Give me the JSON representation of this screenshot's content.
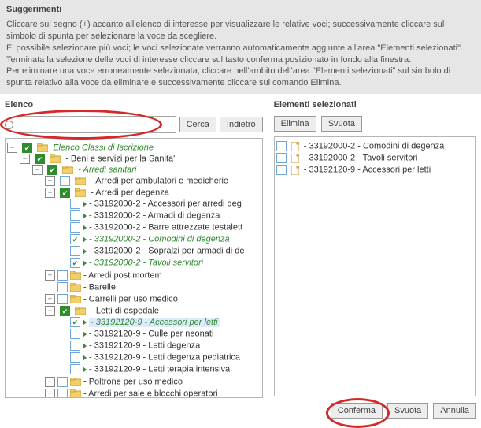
{
  "hints": {
    "title": "Suggerimenti",
    "p1": "Cliccare sul segno (+) accanto all'elenco di interesse per visualizzare le relative voci; successivamente cliccare sul simbolo di spunta per selezionare la voce da scegliere.",
    "p2": "E' possibile selezionare più voci; le voci selezionate verranno automaticamente aggiunte all'area \"Elementi selezionati\".",
    "p3": "Terminata la selezione delle voci di interesse cliccare sul tasto conferma posizionato in fondo alla finestra.",
    "p4": "Per eliminare una voce erroneamente selezionata, cliccare nell'ambito dell'area \"Elementi selezionati\" sul simbolo di spunta relativo alla voce da eliminare e successivamente cliccare sul comando Elimina."
  },
  "left": {
    "title": "Elenco",
    "search_value": "",
    "btn_search": "Cerca",
    "btn_back": "Indietro"
  },
  "right": {
    "title": "Elementi selezionati",
    "btn_del": "Elimina",
    "btn_empty_top": "Svuota",
    "btn_confirm": "Conferma",
    "btn_empty": "Svuota",
    "btn_cancel": "Annulla"
  },
  "tree": {
    "root": "Elenco Classi di Iscrizione",
    "n1": "- Beni e servizi per la Sanita'",
    "n1_1": "- Arredi sanitari",
    "n1_1_1": "- Arredi per ambulatori e medicherie",
    "n1_1_2": "- Arredi per degenza",
    "n1_1_2_1": "- 33192000-2 - Accessori per arredi deg",
    "n1_1_2_2": "- 33192000-2 - Armadi di degenza",
    "n1_1_2_3": "- 33192000-2 - Barre attrezzate testalett",
    "n1_1_2_4": "- 33192000-2 - Comodini di degenza",
    "n1_1_2_5": "- 33192000-2 - Sopralzi per armadi di de",
    "n1_1_2_6": "- 33192000-2 - Tavoli servitori",
    "n1_1_3": "- Arredi post mortem",
    "n1_1_4": "- Barelle",
    "n1_1_5": "- Carrelli per uso medico",
    "n1_1_6": "- Letti di ospedale",
    "n1_1_6_1": "- 33192120-9 - Accessori per letti",
    "n1_1_6_2": "- 33192120-9 - Culle per neonati",
    "n1_1_6_3": "- 33192120-9 - Letti degenza",
    "n1_1_6_4": "- 33192120-9 - Letti degenza pediatrica",
    "n1_1_6_5": "- 33192120-9 - Letti terapia intensiva",
    "n1_1_7": "- Poltrone per uso medico",
    "n1_1_8": "- Arredi per sale e blocchi operatori"
  },
  "selected": {
    "s1": "- 33192000-2 - Comodini di degenza",
    "s2": "- 33192000-2 - Tavoli servitori",
    "s3": "- 33192120-9 - Accessori per letti"
  }
}
